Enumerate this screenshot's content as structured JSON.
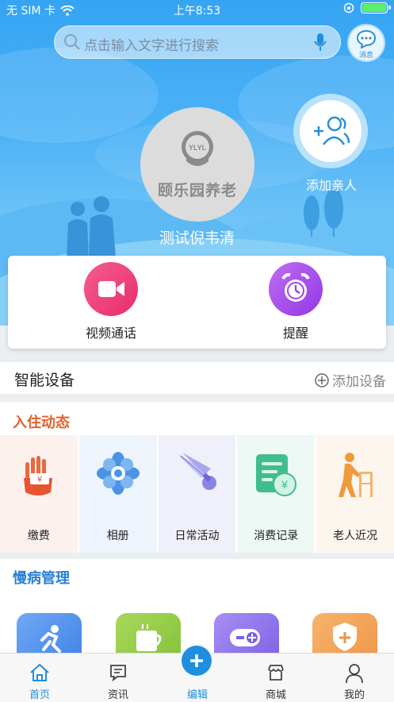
{
  "status_bar": {
    "carrier": "无 SIM 卡",
    "time": "上午8:53"
  },
  "search": {
    "placeholder": "点击输入文字进行搜索"
  },
  "message_button": {
    "label": "消息"
  },
  "profile": {
    "logo_small": "YLYL",
    "logo_text": "颐乐园养老",
    "name": "测试倪韦清"
  },
  "add_relative": {
    "label": "添加亲人"
  },
  "actions": [
    {
      "label": "视频通话",
      "icon": "video-camera-icon",
      "color": "#ee3a78"
    },
    {
      "label": "提醒",
      "icon": "alarm-clock-icon",
      "color": "#a247e8"
    }
  ],
  "devices": {
    "title": "智能设备",
    "add_label": "添加设备"
  },
  "checkin": {
    "title": "入住动态",
    "title_color": "#e2622d",
    "items": [
      {
        "label": "缴费",
        "icon": "payment-hand-icon",
        "bg": "#fdf1ee"
      },
      {
        "label": "相册",
        "icon": "album-flower-icon",
        "bg": "#eef4fc"
      },
      {
        "label": "日常活动",
        "icon": "badminton-icon",
        "bg": "#f0f0fb"
      },
      {
        "label": "消费记录",
        "icon": "consumption-record-icon",
        "bg": "#eef9f5"
      },
      {
        "label": "老人近况",
        "icon": "elderly-walker-icon",
        "bg": "#fdf6ee"
      }
    ]
  },
  "chronic": {
    "title": "慢病管理",
    "title_color": "#2a7fd4"
  },
  "tabbar": {
    "items": [
      {
        "label": "首页",
        "icon": "home-icon",
        "active": true
      },
      {
        "label": "资讯",
        "icon": "news-icon",
        "active": false
      },
      {
        "label": "编辑",
        "icon": "edit-plus-icon",
        "active": true
      },
      {
        "label": "商城",
        "icon": "store-icon",
        "active": false
      },
      {
        "label": "我的",
        "icon": "profile-icon",
        "active": false
      }
    ]
  }
}
